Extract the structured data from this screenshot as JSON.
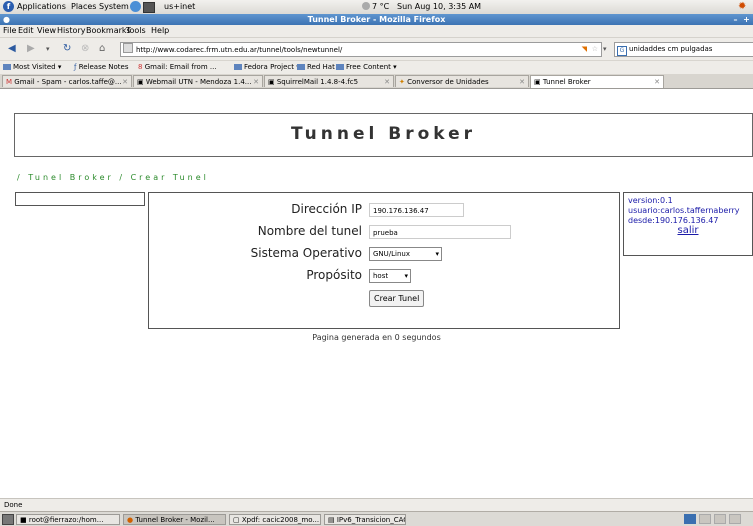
{
  "gnome_panel": {
    "menus": [
      "Applications",
      "Places",
      "System"
    ],
    "user": "us+inet",
    "weather": "7 °C",
    "clock": "Sun Aug 10,  3:35 AM"
  },
  "window": {
    "title": "Tunnel Broker - Mozilla Firefox"
  },
  "menubar": [
    "File",
    "Edit",
    "View",
    "History",
    "Bookmarks",
    "Tools",
    "Help"
  ],
  "navbar": {
    "url": "http://www.codarec.frm.utn.edu.ar/tunnel/tools/newtunnel/",
    "search_value": "unidaddes cm pulgadas"
  },
  "bookmarks": [
    "Most Visited ▾",
    "Release Notes",
    "Gmail: Email from ...",
    "Fedora Project ▾",
    "Red Hat ▾",
    "Free Content ▾"
  ],
  "tabs": [
    {
      "label": "Gmail - Spam - carlos.taffe@..."
    },
    {
      "label": "Webmail UTN - Mendoza 1.4..."
    },
    {
      "label": "SquirrelMail 1.4.8-4.fc5"
    },
    {
      "label": "Conversor de Unidades"
    },
    {
      "label": "Tunnel Broker"
    }
  ],
  "page": {
    "banner_title": "Tunnel Broker",
    "breadcrumb": "/ Tunel Broker / Crear Tunel",
    "form": {
      "ip_label": "Dirección IP",
      "ip_value": "190.176.136.47",
      "name_label": "Nombre del tunel",
      "name_value": "prueba",
      "os_label": "Sistema Operativo",
      "os_value": "GNU/Linux",
      "purpose_label": "Propósito",
      "purpose_value": "host",
      "submit_label": "Crear Tunel"
    },
    "info": {
      "version": "version:0.1",
      "user": "usuario:carlos.taffernaberry",
      "from": "desde:190.176.136.47",
      "logout": "salir"
    },
    "footer": "Pagina generada en 0 segundos"
  },
  "status": "Done",
  "taskbar": [
    "root@fierrazo:/hom...",
    "Tunnel Broker - Mozil...",
    "Xpdf: cacic2008_mo...",
    "IPv6_Transicion_CACI..."
  ]
}
